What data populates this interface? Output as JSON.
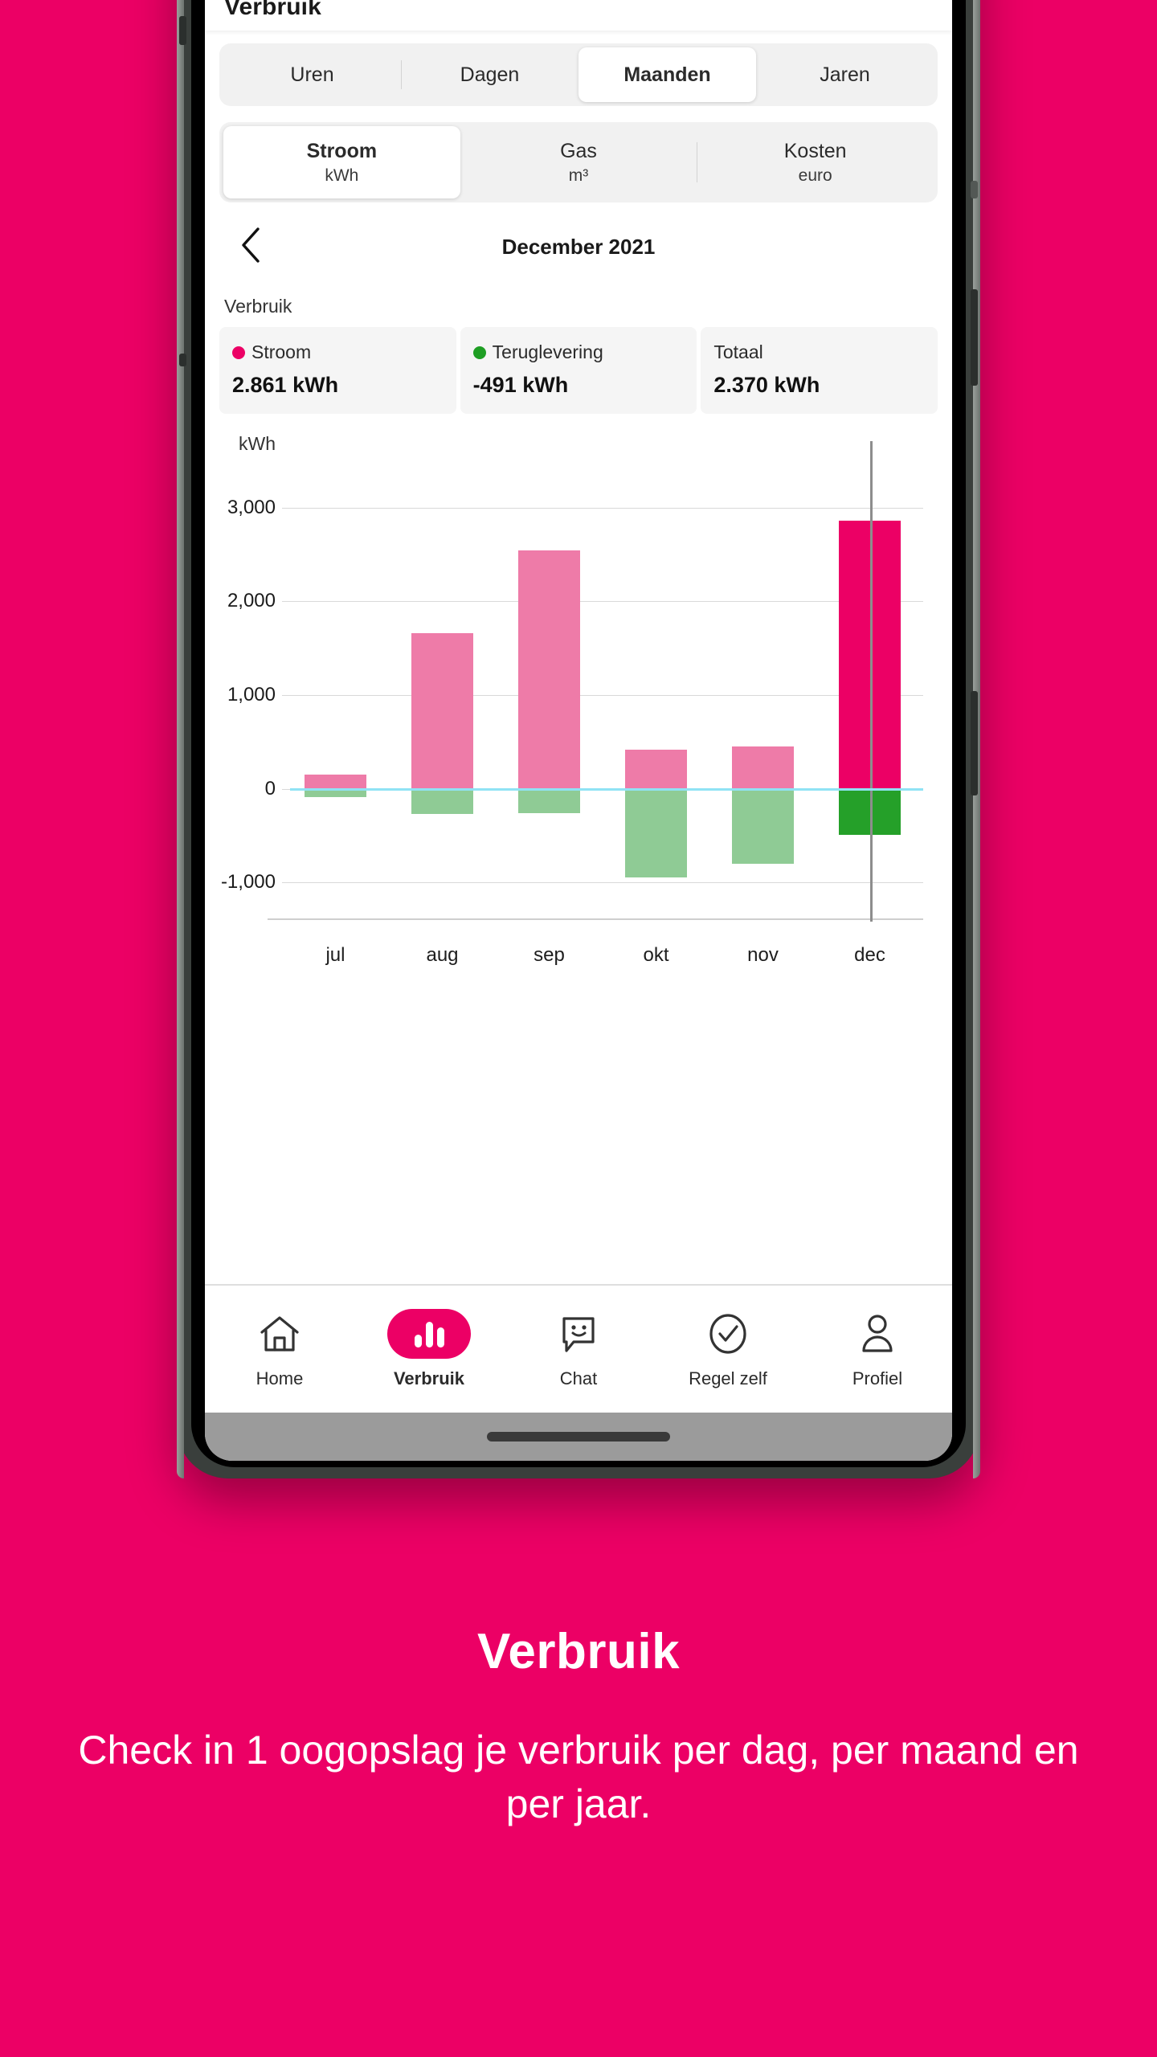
{
  "background_color": "#EC0065",
  "app": {
    "title": "Verbruik"
  },
  "period_tabs": {
    "items": [
      {
        "label": "Uren",
        "active": false
      },
      {
        "label": "Dagen",
        "active": false
      },
      {
        "label": "Maanden",
        "active": true
      },
      {
        "label": "Jaren",
        "active": false
      }
    ]
  },
  "type_tabs": {
    "items": [
      {
        "label": "Stroom",
        "unit": "kWh",
        "active": true
      },
      {
        "label": "Gas",
        "unit": "m³",
        "active": false
      },
      {
        "label": "Kosten",
        "unit": "euro",
        "active": false
      }
    ]
  },
  "period_nav": {
    "back_icon": "chevron-left-icon",
    "current_period": "December 2021"
  },
  "summary": {
    "section_label": "Verbruik",
    "cards": [
      {
        "label": "Stroom",
        "value": "2.861 kWh",
        "dot_color": "#EC0065"
      },
      {
        "label": "Teruglevering",
        "value": "-491 kWh",
        "dot_color": "#1E9E23"
      },
      {
        "label": "Totaal",
        "value": "2.370 kWh",
        "dot_color": null
      }
    ]
  },
  "chart_data": {
    "type": "bar",
    "title": "",
    "subtitle": "",
    "xlabel": "",
    "ylabel": "kWh",
    "unit_label": "kWh",
    "categories": [
      "jul",
      "aug",
      "sep",
      "okt",
      "nov",
      "dec"
    ],
    "series": [
      {
        "name": "Stroom",
        "color": "#EE7BA8",
        "highlight_color": "#EC0065",
        "values": [
          150,
          1660,
          2540,
          420,
          450,
          2861
        ]
      },
      {
        "name": "Teruglevering",
        "color": "#8FCB95",
        "highlight_color": "#25A029",
        "values": [
          -90,
          -265,
          -260,
          -945,
          -800,
          -491
        ]
      }
    ],
    "ylim": [
      -1400,
      3400
    ],
    "yticks": [
      3000,
      2000,
      1000,
      0,
      -1000
    ],
    "ytick_labels": [
      "3,000",
      "2,000",
      "1,000",
      "0",
      "-1,000"
    ],
    "grid": true,
    "legend": "none",
    "selected_category": "dec",
    "zero_line_color": "#8FE3F5",
    "cursor_line_color": "#8D8D8D"
  },
  "bottom_nav": {
    "items": [
      {
        "label": "Home",
        "icon": "home-icon",
        "active": false
      },
      {
        "label": "Verbruik",
        "icon": "bar-chart-icon",
        "active": true
      },
      {
        "label": "Chat",
        "icon": "chat-smiley-icon",
        "active": false
      },
      {
        "label": "Regel zelf",
        "icon": "check-circle-icon",
        "active": false
      },
      {
        "label": "Profiel",
        "icon": "person-icon",
        "active": false
      }
    ]
  },
  "marketing": {
    "title": "Verbruik",
    "subtitle": "Check in 1 oogopslag je verbruik per dag, per maand en per jaar."
  }
}
